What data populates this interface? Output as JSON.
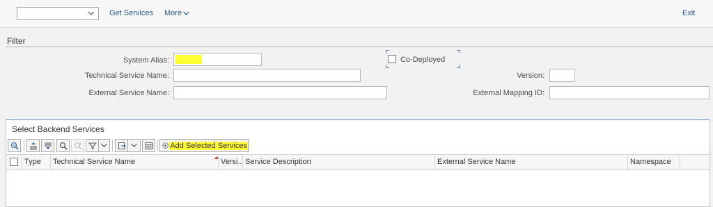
{
  "toolbar": {
    "get_services": "Get Services",
    "more": "More",
    "exit": "Exit"
  },
  "filter": {
    "title": "Filter",
    "system_alias_label": "System Alias:",
    "system_alias_value": "",
    "co_deployed_label": "Co-Deployed",
    "co_deployed_checked": false,
    "technical_service_name_label": "Technical Service Name:",
    "technical_service_name_value": "",
    "version_label": "Version:",
    "version_value": "",
    "external_service_name_label": "External Service Name:",
    "external_service_name_value": "",
    "external_mapping_id_label": "External Mapping ID:",
    "external_mapping_id_value": ""
  },
  "backend": {
    "title": "Select Backend Services",
    "add_selected_label": "Add Selected Services",
    "columns": {
      "type": "Type",
      "technical_service_name": "Technical Service Name",
      "version": "Versi...",
      "service_description": "Service Description",
      "external_service_name": "External Service Name",
      "namespace": "Namespace"
    },
    "rows": []
  },
  "colors": {
    "link": "#2a5a8a",
    "highlight": "#ffff33",
    "panel_border": "#6c8fb3"
  }
}
